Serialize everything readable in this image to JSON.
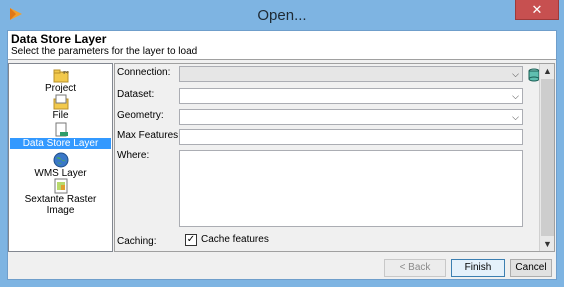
{
  "window": {
    "title": "Open...",
    "close_glyph": "✕"
  },
  "header": {
    "title": "Data Store Layer",
    "subtitle": "Select the parameters for the layer to load"
  },
  "sidebar": {
    "items": [
      {
        "label": "Project",
        "icon": "project-icon",
        "selected": false
      },
      {
        "label": "File",
        "icon": "file-icon",
        "selected": false
      },
      {
        "label": "Data Store Layer",
        "icon": "data-store-icon",
        "selected": true
      },
      {
        "label": "WMS Layer",
        "icon": "globe-icon",
        "selected": false
      },
      {
        "label": "Sextante Raster Image",
        "icon": "raster-image-icon",
        "selected": false
      }
    ]
  },
  "form": {
    "connection_label": "Connection:",
    "connection_value": "",
    "dataset_label": "Dataset:",
    "dataset_value": "",
    "geometry_label": "Geometry:",
    "geometry_value": "",
    "max_features_label": "Max Features:",
    "max_features_value": "",
    "where_label": "Where:",
    "where_value": "",
    "caching_label": "Caching:",
    "cache_checkbox_label": "Cache features",
    "cache_checked": true
  },
  "footer": {
    "back_label": "< Back",
    "finish_label": "Finish",
    "cancel_label": "Cancel"
  },
  "colors": {
    "frame": "#7eb4e2",
    "close": "#c75050",
    "selection": "#3399ff"
  }
}
